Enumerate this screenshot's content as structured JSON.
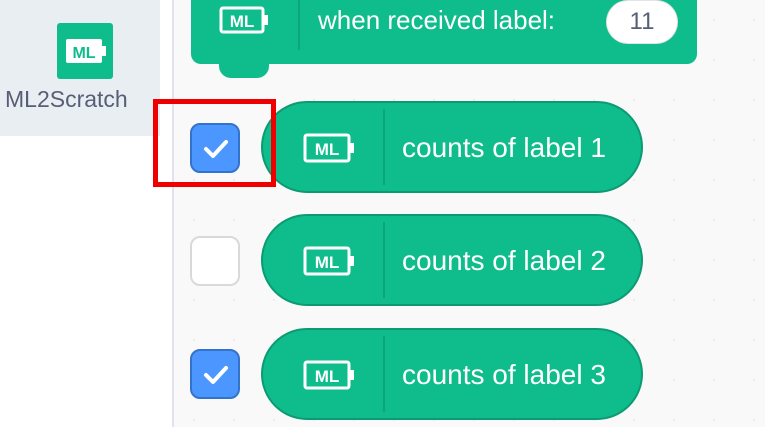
{
  "sidebar": {
    "category_label": "ML2Scratch",
    "category_icon": "ml-icon",
    "category_color": "#0fbd8c"
  },
  "hat_block": {
    "text": "when received label:",
    "input_value": "11",
    "icon": "ml-icon"
  },
  "reporters": [
    {
      "label": "counts of label 1",
      "checked": true
    },
    {
      "label": "counts of label 2",
      "checked": false
    },
    {
      "label": "counts of label 3",
      "checked": true
    }
  ],
  "colors": {
    "block_green": "#0fbd8c",
    "checkbox_blue": "#4c97ff",
    "highlight_red": "#ee0000"
  }
}
